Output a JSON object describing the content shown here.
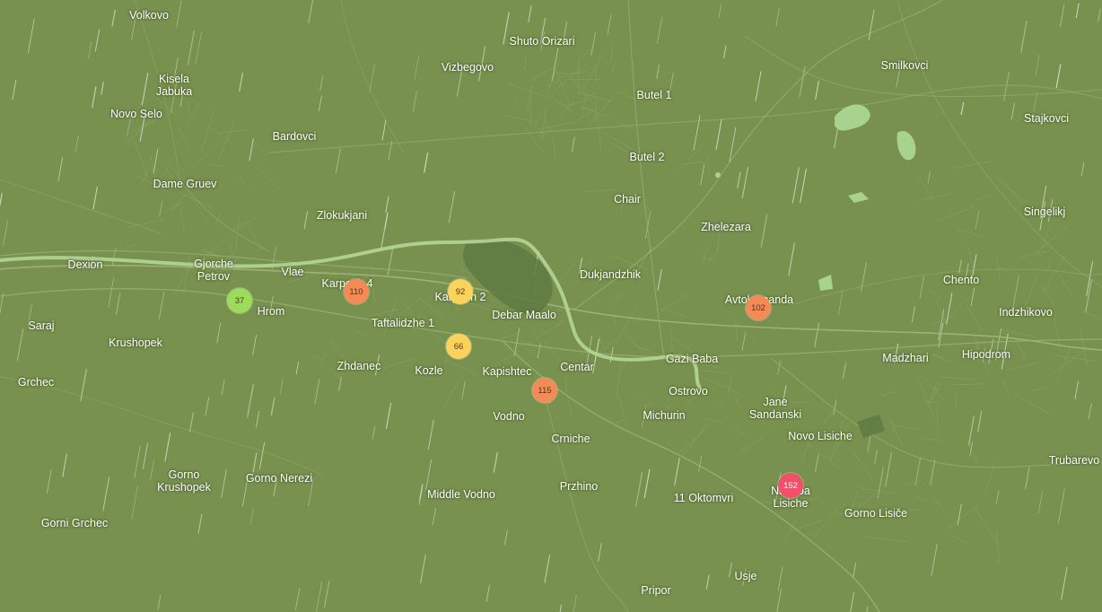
{
  "map": {
    "background": "#78914f",
    "road_color": "#9fb37a",
    "river_color": "#b3d696",
    "park_color": "#5c7a40",
    "water_color": "#a8d38f"
  },
  "places": [
    {
      "name": "Volkovo"
    },
    {
      "name": "Shuto Orizari"
    },
    {
      "name": "Vizbegovo"
    },
    {
      "name": "Smilkovci"
    },
    {
      "name": "Kisela\nJabuka"
    },
    {
      "name": "Butel 1"
    },
    {
      "name": "Novo Selo"
    },
    {
      "name": "Stajkovci"
    },
    {
      "name": "Bardovci"
    },
    {
      "name": "Butel 2"
    },
    {
      "name": "Dame Gruev"
    },
    {
      "name": "Chair"
    },
    {
      "name": "Singelikj"
    },
    {
      "name": "Zlokukjani"
    },
    {
      "name": "Zhelezara"
    },
    {
      "name": "Dexion"
    },
    {
      "name": "Gjorche\nPetrov"
    },
    {
      "name": "Vlae"
    },
    {
      "name": "Dukjandzhik"
    },
    {
      "name": "Chento"
    },
    {
      "name": "Karposh 4"
    },
    {
      "name": "Karposh 2"
    },
    {
      "name": "Avtokomanda"
    },
    {
      "name": "Hrom"
    },
    {
      "name": "Debar Maalo"
    },
    {
      "name": "Indzhikovo"
    },
    {
      "name": "Saraj"
    },
    {
      "name": "Taftalidzhe 1"
    },
    {
      "name": "Krushopek"
    },
    {
      "name": "Hipodrom"
    },
    {
      "name": "Madzhari"
    },
    {
      "name": "Gazi Baba"
    },
    {
      "name": "Zhdanec"
    },
    {
      "name": "Centar"
    },
    {
      "name": "Kozle"
    },
    {
      "name": "Kapishtec"
    },
    {
      "name": "Grchec"
    },
    {
      "name": "Ostrovo"
    },
    {
      "name": "Jane\nSandanski"
    },
    {
      "name": "Vodno"
    },
    {
      "name": "Michurin"
    },
    {
      "name": "Novo Lisiche"
    },
    {
      "name": "Crniche"
    },
    {
      "name": "Trubarevo"
    },
    {
      "name": "Gorno\nKrushopek"
    },
    {
      "name": "Gorno Nerezi"
    },
    {
      "name": "Przhino"
    },
    {
      "name": "Nadeba\nLisiche"
    },
    {
      "name": "Middle Vodno"
    },
    {
      "name": "11 Oktomvri"
    },
    {
      "name": "Gorno Lisiče"
    },
    {
      "name": "Gorni Grchec"
    },
    {
      "name": "Usje"
    },
    {
      "name": "Pripor"
    }
  ],
  "aqi_markers": [
    {
      "value": "37",
      "color": "#9ddb5a"
    },
    {
      "value": "110",
      "color": "#f48a55"
    },
    {
      "value": "92",
      "color": "#fbd25a"
    },
    {
      "value": "66",
      "color": "#fbd25a"
    },
    {
      "value": "115",
      "color": "#f48a55"
    },
    {
      "value": "102",
      "color": "#f48a55"
    },
    {
      "value": "152",
      "color": "#f0506a"
    }
  ]
}
